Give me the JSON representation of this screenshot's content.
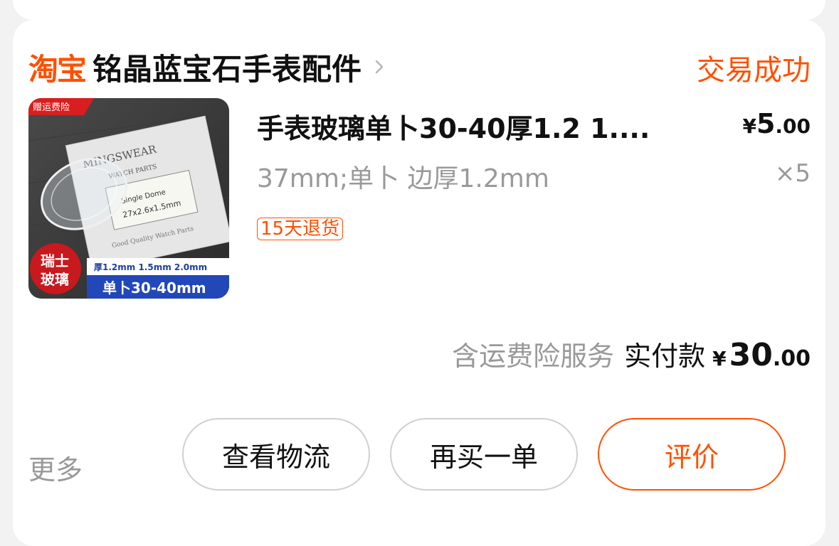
{
  "shop": {
    "logo_text": "淘宝",
    "name": "铭晶蓝宝石手表配件",
    "status": "交易成功"
  },
  "product": {
    "title": "手表玻璃单卜30-40厚1.2 1....",
    "price_symbol": "¥",
    "price_int": "5",
    "price_dec": ".00",
    "spec": "37mm;单卜 边厚1.2mm",
    "quantity": "×5",
    "return_badge": "15天退货",
    "image": {
      "corner_tag": "赠运费险",
      "brand": "MINGSWEAR",
      "sub": "WATCH PARTS",
      "dome": "Single Dome",
      "size": "27x2.6x1.5mm",
      "quality": "Good Quality Watch Parts",
      "badge_line1": "瑞士",
      "badge_line2": "玻璃",
      "thickness": "厚1.2mm 1.5mm 2.0mm",
      "range": "单卜30-40mm"
    }
  },
  "summary": {
    "insurance_note": "含运费险服务",
    "paid_label": "实付款",
    "currency": "¥",
    "total_int": "30",
    "total_dec": ".00"
  },
  "actions": {
    "more": "更多",
    "logistics": "查看物流",
    "rebuy": "再买一单",
    "review": "评价"
  },
  "colors": {
    "accent": "#ff5000",
    "muted": "#999999"
  }
}
